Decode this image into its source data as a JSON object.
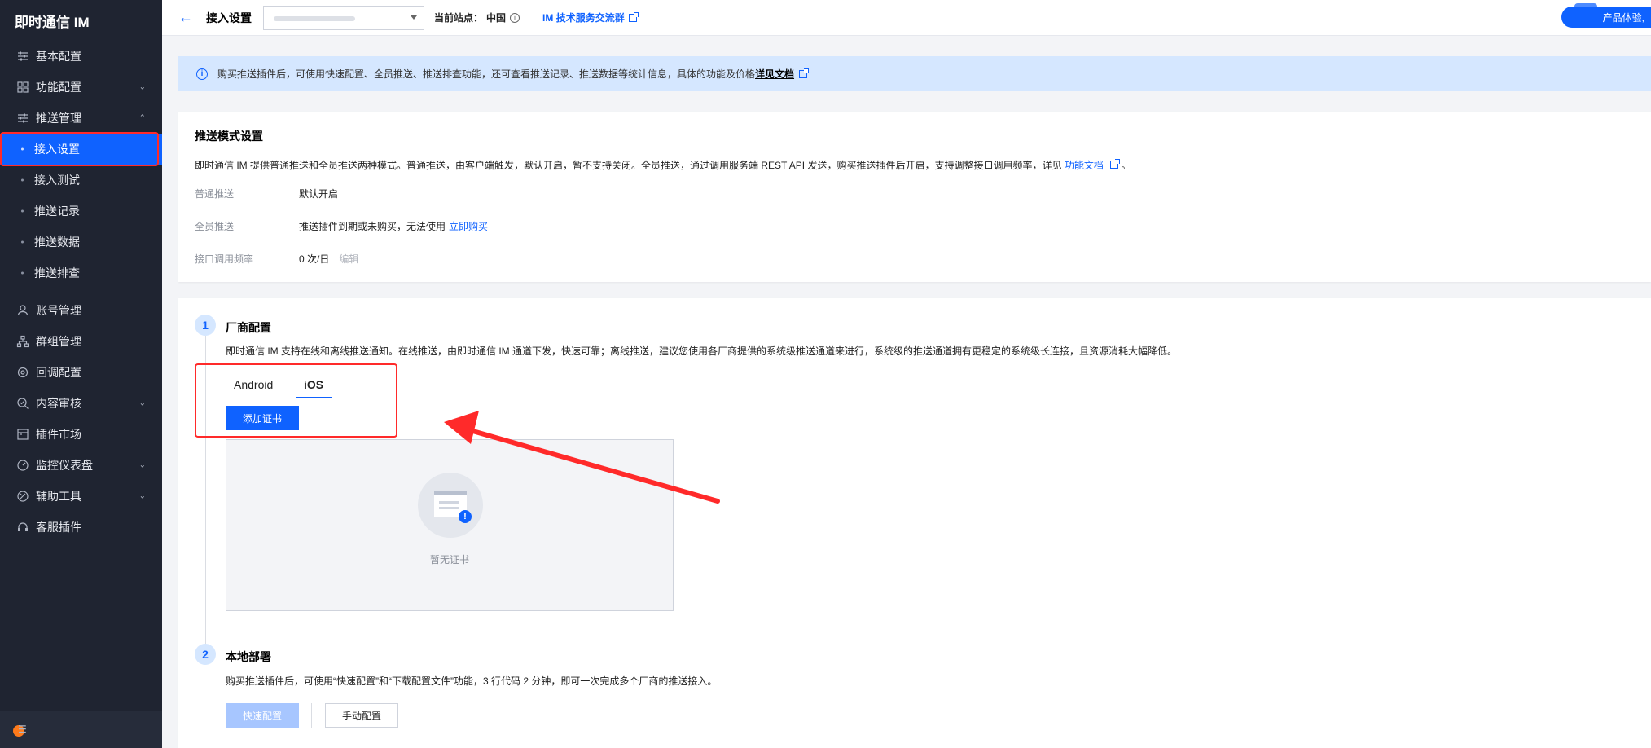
{
  "sidebar": {
    "brand": "即时通信 IM",
    "items": [
      {
        "label": "基本配置"
      },
      {
        "label": "功能配置"
      },
      {
        "label": "推送管理"
      },
      {
        "label": "账号管理"
      },
      {
        "label": "群组管理"
      },
      {
        "label": "回调配置"
      },
      {
        "label": "内容审核"
      },
      {
        "label": "插件市场"
      },
      {
        "label": "监控仪表盘"
      },
      {
        "label": "辅助工具"
      },
      {
        "label": "客服插件"
      }
    ],
    "push_subitems": [
      {
        "label": "接入设置"
      },
      {
        "label": "接入测试"
      },
      {
        "label": "推送记录"
      },
      {
        "label": "推送数据"
      },
      {
        "label": "推送排查"
      }
    ]
  },
  "topbar": {
    "title": "接入设置",
    "site_label": "当前站点：",
    "site_value": "中国",
    "group_link": "IM 技术服务交流群",
    "trial_label": "产品体验,"
  },
  "alert": {
    "text": "购买推送插件后，可使用快速配置、全员推送、推送排查功能，还可查看推送记录、推送数据等统计信息，具体的功能及价格",
    "link": "详见文档"
  },
  "push_mode": {
    "title": "推送模式设置",
    "desc_prefix": "即时通信 IM 提供普通推送和全员推送两种模式。普通推送，由客户端触发，默认开启，暂不支持关闭。全员推送，通过调用服务端 REST API 发送，购买推送插件后开启，支持调整接口调用频率，详见",
    "desc_link": "功能文档",
    "desc_suffix": "。",
    "rows": [
      {
        "key": "普通推送",
        "value": "默认开启"
      },
      {
        "key": "全员推送",
        "value": "推送插件到期或未购买，无法使用",
        "link": "立即购买"
      },
      {
        "key": "接口调用频率",
        "value": "0 次/日",
        "action": "编辑"
      }
    ]
  },
  "vendor": {
    "step": "1",
    "title": "厂商配置",
    "desc": "即时通信 IM 支持在线和离线推送通知。在线推送，由即时通信 IM 通道下发，快速可靠；离线推送，建议您使用各厂商提供的系统级推送通道来进行，系统级的推送通道拥有更稳定的系统级长连接，且资源消耗大幅降低。",
    "tabs": [
      {
        "label": "Android"
      },
      {
        "label": "iOS"
      }
    ],
    "add_cert": "添加证书",
    "empty_text": "暂无证书"
  },
  "local": {
    "step": "2",
    "title": "本地部署",
    "desc": "购买推送插件后，可使用“快速配置”和“下载配置文件”功能，3 行代码 2 分钟，即可一次完成多个厂商的推送接入。",
    "quick_config": "快速配置",
    "manual_config": "手动配置"
  },
  "colors": {
    "primary": "#0f62ff",
    "sidebar_bg": "#1f2431",
    "annotation": "#ff2a2a"
  }
}
